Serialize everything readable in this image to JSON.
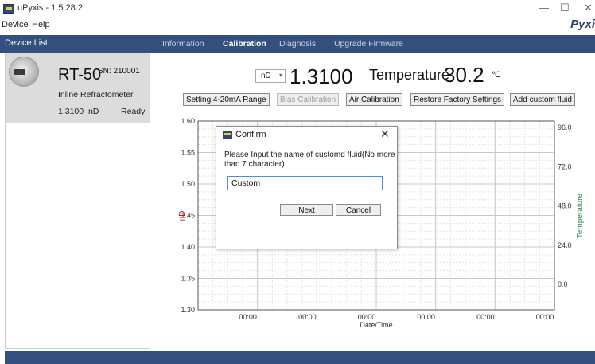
{
  "window": {
    "title": "uPyxis - 1.5.28.2",
    "brand": "Pyxi",
    "minimize": "—",
    "maximize": "☐",
    "close": "✕"
  },
  "menu": [
    "Device",
    "Help"
  ],
  "sidebar": {
    "header": "Device List",
    "device": {
      "model": "RT-50",
      "sn": "SN: 210001",
      "type": "Inline Refractometer",
      "reading": "1.3100  nD",
      "status": "Ready"
    }
  },
  "tabs": [
    {
      "label": "Information",
      "active": false
    },
    {
      "label": "Calibration",
      "active": true
    },
    {
      "label": "Diagnosis",
      "active": false
    },
    {
      "label": "Upgrade Firmware",
      "active": false
    }
  ],
  "readout": {
    "unit": "nD",
    "value": "1.3100",
    "temp_label": "Temperature",
    "temp_value": "30.2",
    "temp_unit": "℃"
  },
  "actions": [
    {
      "label": "Setting 4-20mA Range",
      "enabled": true
    },
    {
      "label": "Bias Calibration",
      "enabled": false
    },
    {
      "label": "Air Calibration",
      "enabled": true
    },
    {
      "label": "Restore Factory Settings",
      "enabled": true
    },
    {
      "label": "Add custom fluid",
      "enabled": true
    }
  ],
  "chart": {
    "ylabel_left": "nD",
    "ylabel_right": "Temperature",
    "xlabel": "Date/Time",
    "left_ticks": [
      "1.60",
      "1.55",
      "1.50",
      "1.45",
      "1.40",
      "1.35",
      "1.30"
    ],
    "right_ticks": [
      "96.0",
      "72.0",
      "48.0",
      "24.0",
      "0.0"
    ],
    "x_ticks": [
      "00:00",
      "00:00",
      "00:00",
      "00:00",
      "00:00",
      "00:00"
    ],
    "colors": {
      "left_axis": "#cc0000",
      "right_axis": "#2e8b57"
    }
  },
  "dialog": {
    "title": "Confirm",
    "close": "✕",
    "message": "Please Input the name of customd fluid(No more than 7 character)",
    "input_value": "Custom",
    "next": "Next",
    "cancel": "Cancel"
  },
  "colors": {
    "accent": "#34507f"
  }
}
